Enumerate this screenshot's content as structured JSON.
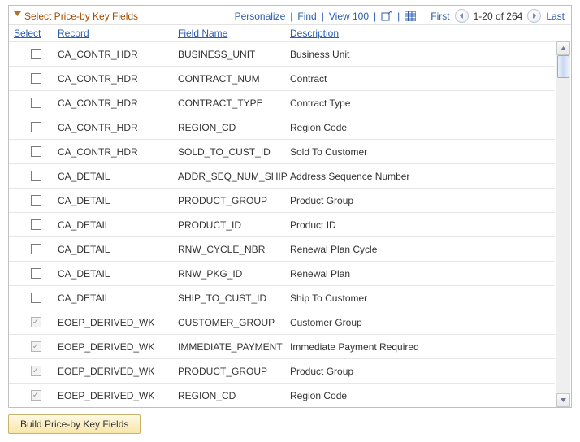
{
  "grid": {
    "title": "Select Price-by Key Fields",
    "actions": {
      "personalize": "Personalize",
      "find": "Find",
      "view_all": "View 100"
    },
    "nav": {
      "first": "First",
      "last": "Last",
      "range": "1-20 of 264"
    },
    "columns": {
      "select": "Select",
      "record": "Record",
      "field_name": "Field Name",
      "description": "Description"
    },
    "rows": [
      {
        "selected": false,
        "locked": false,
        "record": "CA_CONTR_HDR",
        "field": "BUSINESS_UNIT",
        "desc": "Business Unit"
      },
      {
        "selected": false,
        "locked": false,
        "record": "CA_CONTR_HDR",
        "field": "CONTRACT_NUM",
        "desc": "Contract"
      },
      {
        "selected": false,
        "locked": false,
        "record": "CA_CONTR_HDR",
        "field": "CONTRACT_TYPE",
        "desc": "Contract Type"
      },
      {
        "selected": false,
        "locked": false,
        "record": "CA_CONTR_HDR",
        "field": "REGION_CD",
        "desc": "Region Code"
      },
      {
        "selected": false,
        "locked": false,
        "record": "CA_CONTR_HDR",
        "field": "SOLD_TO_CUST_ID",
        "desc": "Sold To Customer"
      },
      {
        "selected": false,
        "locked": false,
        "record": "CA_DETAIL",
        "field": "ADDR_SEQ_NUM_SHIP",
        "desc": "Address Sequence Number"
      },
      {
        "selected": false,
        "locked": false,
        "record": "CA_DETAIL",
        "field": "PRODUCT_GROUP",
        "desc": "Product Group"
      },
      {
        "selected": false,
        "locked": false,
        "record": "CA_DETAIL",
        "field": "PRODUCT_ID",
        "desc": "Product ID"
      },
      {
        "selected": false,
        "locked": false,
        "record": "CA_DETAIL",
        "field": "RNW_CYCLE_NBR",
        "desc": "Renewal Plan Cycle"
      },
      {
        "selected": false,
        "locked": false,
        "record": "CA_DETAIL",
        "field": "RNW_PKG_ID",
        "desc": "Renewal Plan"
      },
      {
        "selected": false,
        "locked": false,
        "record": "CA_DETAIL",
        "field": "SHIP_TO_CUST_ID",
        "desc": "Ship To Customer"
      },
      {
        "selected": true,
        "locked": true,
        "record": "EOEP_DERIVED_WK",
        "field": "CUSTOMER_GROUP",
        "desc": "Customer Group"
      },
      {
        "selected": true,
        "locked": true,
        "record": "EOEP_DERIVED_WK",
        "field": "IMMEDIATE_PAYMENT",
        "desc": "Immediate Payment Required"
      },
      {
        "selected": true,
        "locked": true,
        "record": "EOEP_DERIVED_WK",
        "field": "PRODUCT_GROUP",
        "desc": "Product Group"
      },
      {
        "selected": true,
        "locked": true,
        "record": "EOEP_DERIVED_WK",
        "field": "REGION_CD",
        "desc": "Region Code"
      }
    ]
  },
  "buttons": {
    "build": "Build Price-by Key Fields"
  }
}
